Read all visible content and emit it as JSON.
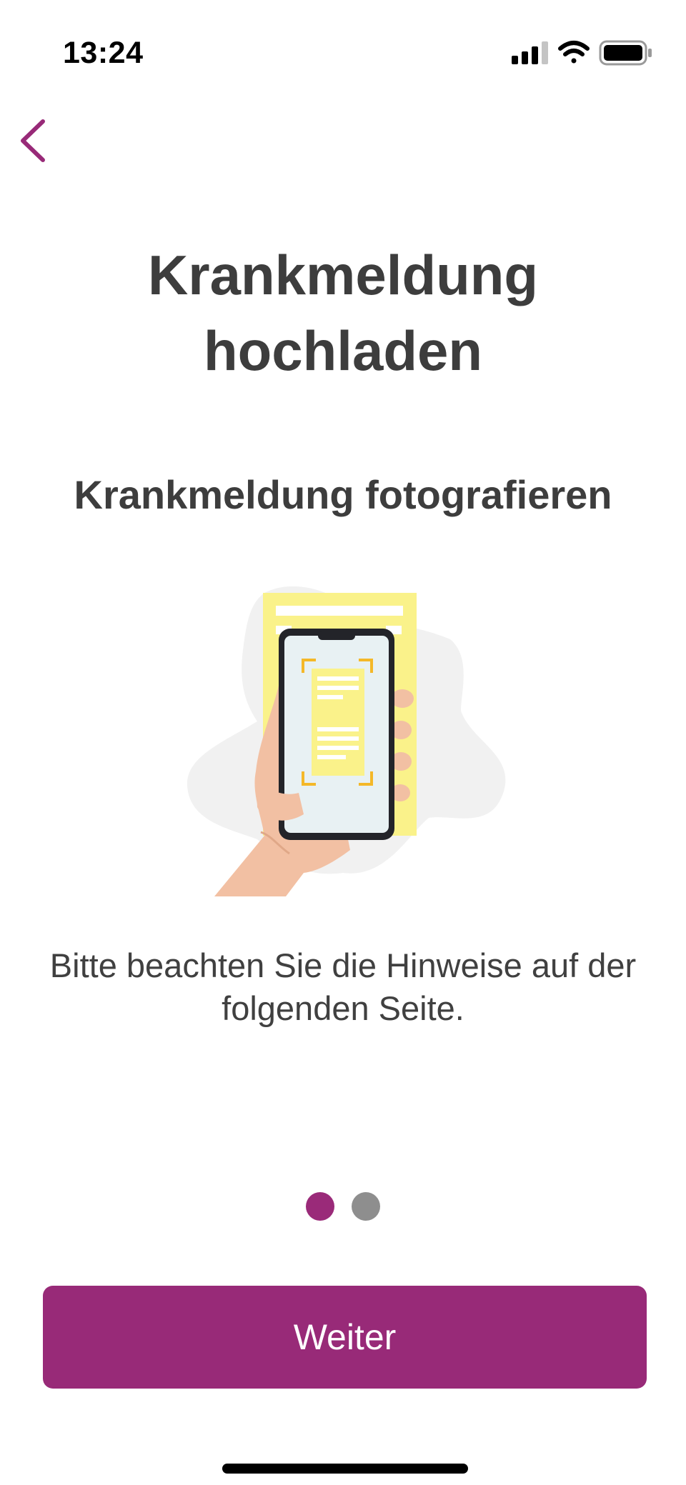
{
  "status_bar": {
    "time": "13:24",
    "signal_icon": "cellular-signal-icon",
    "wifi_icon": "wifi-icon",
    "battery_icon": "battery-icon"
  },
  "navigation": {
    "back_icon": "chevron-left-icon"
  },
  "header": {
    "title": "Krankmeldung\nhochladen"
  },
  "step": {
    "title": "Krankmeldung fotografieren",
    "illustration": "hand-holding-phone-scanning-document-illustration",
    "hint": "Bitte beachten Sie die Hinweise auf der folgenden Seite."
  },
  "pager": {
    "current": 1,
    "total": 2
  },
  "footer": {
    "continue_label": "Weiter"
  },
  "colors": {
    "accent": "#982a78",
    "page_dot_inactive": "#8e8e8e",
    "text": "#3d3d3d"
  }
}
